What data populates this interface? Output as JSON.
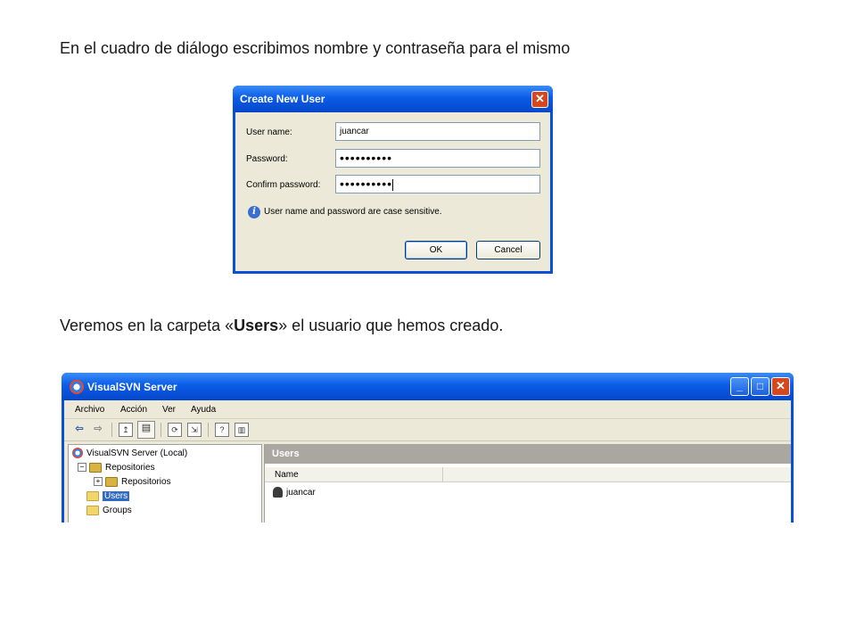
{
  "captions": {
    "first": "En el cuadro de diálogo escribimos nombre y contraseña para el mismo",
    "second_prefix": "Veremos en la carpeta «",
    "second_bold": "Users",
    "second_suffix": "» el usuario que hemos creado."
  },
  "dialog": {
    "title": "Create New User",
    "close_glyph": "✕",
    "username_label": "User name:",
    "username_value": "juancar",
    "password_label": "Password:",
    "password_value": "••••••••••",
    "confirm_label": "Confirm password:",
    "confirm_value": "••••••••••",
    "info_text": "User name and password are case sensitive.",
    "ok_label": "OK",
    "cancel_label": "Cancel"
  },
  "window": {
    "title": "VisualSVN Server",
    "menu": [
      "Archivo",
      "Acción",
      "Ver",
      "Ayuda"
    ],
    "toolbar_icons": [
      "back-arrow-icon",
      "forward-arrow-icon",
      "up-folder-icon",
      "show-tree-icon",
      "refresh-icon",
      "export-list-icon",
      "help-icon",
      "show-panel-icon"
    ],
    "tree": {
      "root": "VisualSVN Server (Local)",
      "repositories": "Repositories",
      "repositorios": "Repositorios",
      "users": "Users",
      "groups": "Groups"
    },
    "pane_title": "Users",
    "column_name": "Name",
    "users": [
      "juancar"
    ]
  }
}
